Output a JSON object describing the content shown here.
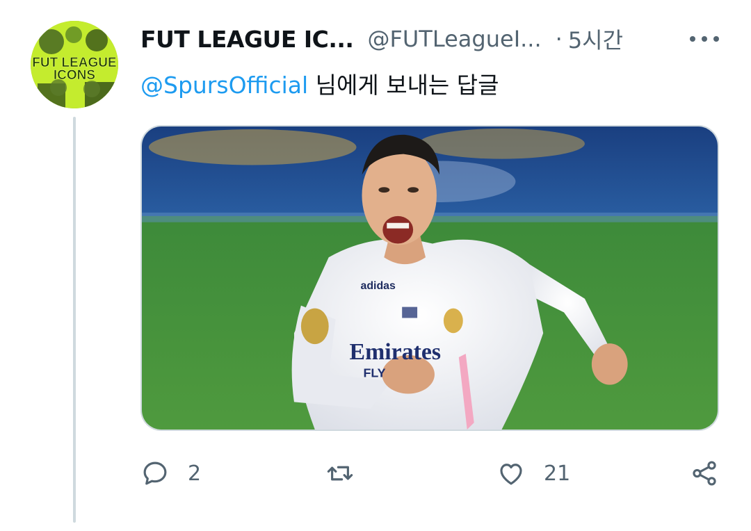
{
  "tweet": {
    "author": {
      "display_name": "FUT LEAGUE IC...",
      "handle": "@FUTLeagueI...",
      "avatar_text": [
        "FUT LEAGUE",
        "ICONS"
      ]
    },
    "separator": "·",
    "time": "5시간",
    "reply_to": {
      "mention": "@SpursOfficial",
      "suffix": " 님에게 보내는 답글"
    },
    "media": {
      "kit_text": [
        "Emirates",
        "FLY"
      ],
      "brand_text": "adidas"
    },
    "actions": {
      "reply_count": "2",
      "retweet_count": "",
      "like_count": "21"
    }
  },
  "colors": {
    "link": "#1d9bf0",
    "secondary": "#536471",
    "primary_text": "#0f1419",
    "border": "#cfd9de"
  },
  "icons": [
    "more-icon",
    "reply-icon",
    "retweet-icon",
    "like-icon",
    "share-icon"
  ]
}
